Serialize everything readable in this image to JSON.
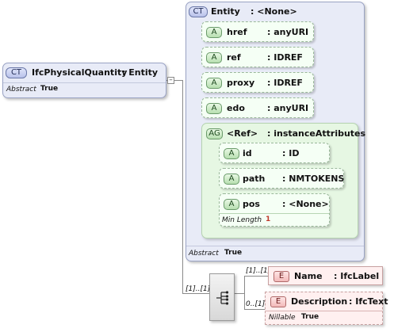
{
  "root": {
    "badge": "CT",
    "name": "IfcPhysicalQuantity",
    "type": ": Entity",
    "prop_label": "Abstract",
    "prop_value": "True"
  },
  "entity": {
    "badge": "CT",
    "name": "Entity",
    "type": ": <None>",
    "prop_label": "Abstract",
    "prop_value": "True",
    "attributes": [
      {
        "badge": "A",
        "name": "href",
        "type": ": anyURI"
      },
      {
        "badge": "A",
        "name": "ref",
        "type": ": IDREF"
      },
      {
        "badge": "A",
        "name": "proxy",
        "type": ": IDREF"
      },
      {
        "badge": "A",
        "name": "edo",
        "type": ": anyURI"
      }
    ],
    "group": {
      "badge": "AG",
      "name": "<Ref>",
      "type": ": instanceAttributes",
      "attributes": [
        {
          "badge": "A",
          "name": "id",
          "type": ": ID"
        },
        {
          "badge": "A",
          "name": "path",
          "type": ": NMTOKENS"
        },
        {
          "badge": "A",
          "name": "pos",
          "type": ": <None>",
          "facet_label": "Min Length",
          "facet_value": "1"
        }
      ]
    }
  },
  "sequence": {
    "multiplicity": "[1]..[1]",
    "elements": [
      {
        "badge": "E",
        "name": "Name",
        "type": ": IfcLabel",
        "multiplicity": "[1]..[1]"
      },
      {
        "badge": "E",
        "name": "Description",
        "type": ": IfcText",
        "multiplicity": "0..[1]",
        "prop_label": "Nillable",
        "prop_value": "True"
      }
    ]
  },
  "colors": {
    "complex_type": "#e8ebf7",
    "attribute": "#f5fff5",
    "element": "#fff0f0"
  }
}
